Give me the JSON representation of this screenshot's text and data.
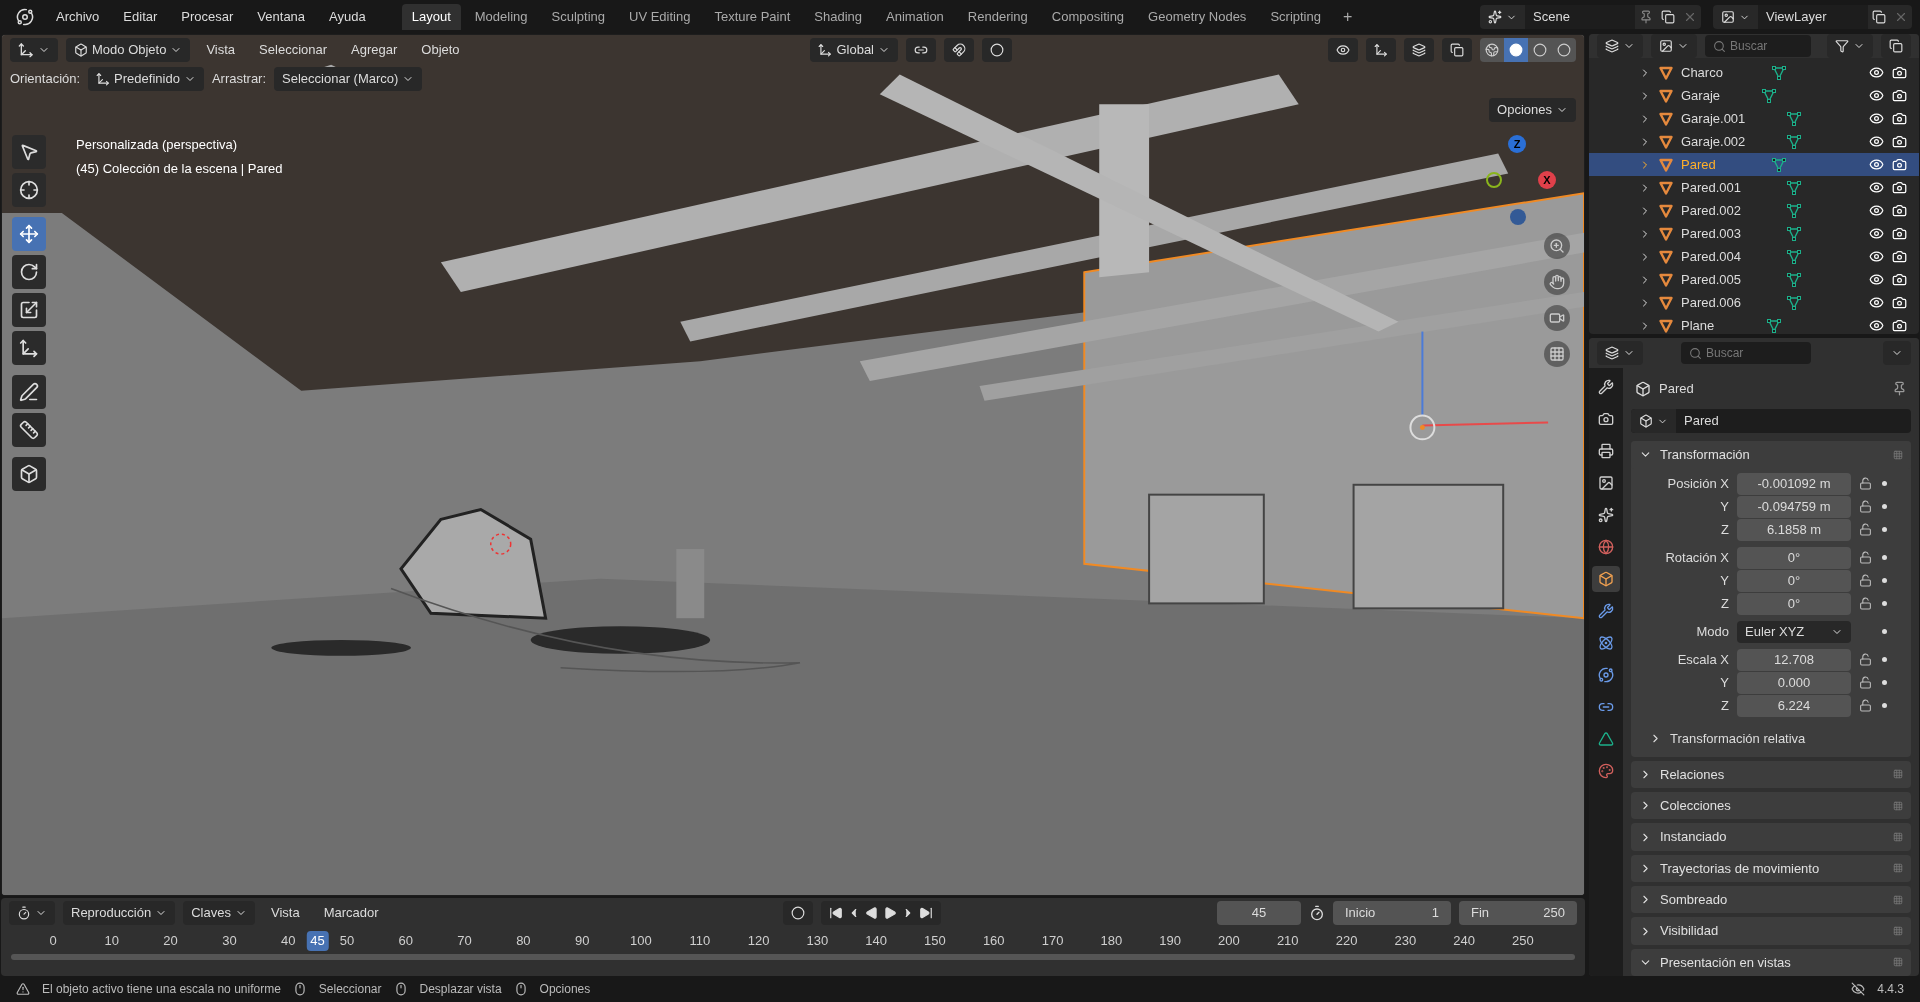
{
  "menu": [
    "Archivo",
    "Editar",
    "Procesar",
    "Ventana",
    "Ayuda"
  ],
  "workspaces": [
    {
      "label": "Layout",
      "selected": true
    },
    {
      "label": "Modeling",
      "selected": false
    },
    {
      "label": "Sculpting",
      "selected": false
    },
    {
      "label": "UV Editing",
      "selected": false
    },
    {
      "label": "Texture Paint",
      "selected": false
    },
    {
      "label": "Shading",
      "selected": false
    },
    {
      "label": "Animation",
      "selected": false
    },
    {
      "label": "Rendering",
      "selected": false
    },
    {
      "label": "Compositing",
      "selected": false
    },
    {
      "label": "Geometry Nodes",
      "selected": false
    },
    {
      "label": "Scripting",
      "selected": false
    }
  ],
  "add_workspace": "+",
  "scene": "Scene",
  "view_layer": "ViewLayer",
  "viewport": {
    "mode": "Modo Objeto",
    "menus": [
      "Vista",
      "Seleccionar",
      "Agregar",
      "Objeto"
    ],
    "transform_orientation": "Global",
    "orientation_label": "Orientación:",
    "orientation_value": "Predefinido",
    "drag_label": "Arrastrar:",
    "drag_value": "Seleccionar (Marco)",
    "options": "Opciones",
    "view_name": "Personalizada (perspectiva)",
    "collection_info": "(45) Colección de la escena | Pared",
    "tools": [
      {
        "kind": "select",
        "selected": false
      },
      {
        "kind": "cursor",
        "selected": false
      },
      {
        "kind": "move",
        "selected": true
      },
      {
        "kind": "rotate",
        "selected": false
      },
      {
        "kind": "scale",
        "selected": false
      },
      {
        "kind": "transform",
        "selected": false
      },
      {
        "kind": "annotate",
        "selected": false
      },
      {
        "kind": "measure",
        "selected": false
      },
      {
        "kind": "add",
        "selected": false
      }
    ],
    "shading_modes": [
      {
        "kind": "wireframe",
        "selected": false
      },
      {
        "kind": "solid",
        "selected": true
      },
      {
        "kind": "material",
        "selected": false
      },
      {
        "kind": "rendered",
        "selected": false
      }
    ],
    "gizmo": {
      "z": "Z",
      "x": "X"
    }
  },
  "outliner": {
    "search": {
      "placeholder": "Buscar"
    },
    "items": [
      {
        "name": "Charco",
        "selected": false
      },
      {
        "name": "Garaje",
        "selected": false
      },
      {
        "name": "Garaje.001",
        "selected": false
      },
      {
        "name": "Garaje.002",
        "selected": false
      },
      {
        "name": "Pared",
        "selected": true
      },
      {
        "name": "Pared.001",
        "selected": false
      },
      {
        "name": "Pared.002",
        "selected": false
      },
      {
        "name": "Pared.003",
        "selected": false
      },
      {
        "name": "Pared.004",
        "selected": false
      },
      {
        "name": "Pared.005",
        "selected": false
      },
      {
        "name": "Pared.006",
        "selected": false
      },
      {
        "name": "Plane",
        "selected": false
      }
    ]
  },
  "properties": {
    "search": {
      "placeholder": "Buscar"
    },
    "tabs": [
      {
        "kind": "tool",
        "selected": false
      },
      {
        "kind": "render",
        "selected": false
      },
      {
        "kind": "output",
        "selected": false
      },
      {
        "kind": "view_layer",
        "selected": false
      },
      {
        "kind": "scene",
        "selected": false
      },
      {
        "kind": "world",
        "selected": false
      },
      {
        "kind": "object",
        "selected": true
      },
      {
        "kind": "modifiers",
        "selected": false
      },
      {
        "kind": "particles",
        "selected": false
      },
      {
        "kind": "physics",
        "selected": false
      },
      {
        "kind": "constraints",
        "selected": false
      },
      {
        "kind": "data",
        "selected": false
      },
      {
        "kind": "material",
        "selected": false
      }
    ],
    "object_name": "Pared",
    "datablock": "Pared",
    "transform": {
      "title": "Transformación",
      "expanded": true,
      "groups": [
        {
          "rows": [
            {
              "label": "Posición X",
              "value": "-0.001092 m"
            },
            {
              "label": "Y",
              "value": "-0.094759 m"
            },
            {
              "label": "Z",
              "value": "6.1858 m"
            }
          ]
        },
        {
          "rows": [
            {
              "label": "Rotación X",
              "value": "0°"
            },
            {
              "label": "Y",
              "value": "0°"
            },
            {
              "label": "Z",
              "value": "0°"
            }
          ]
        },
        {
          "mode_label": "Modo",
          "mode_value": "Euler XYZ"
        },
        {
          "rows": [
            {
              "label": "Escala X",
              "value": "12.708"
            },
            {
              "label": "Y",
              "value": "0.000"
            },
            {
              "label": "Z",
              "value": "6.224"
            }
          ]
        }
      ],
      "subpanel": {
        "title": "Transformación relativa",
        "expanded": false
      }
    },
    "panels": [
      {
        "title": "Relaciones",
        "expanded": false
      },
      {
        "title": "Colecciones",
        "expanded": false
      },
      {
        "title": "Instanciado",
        "expanded": false
      },
      {
        "title": "Trayectorias de movimiento",
        "expanded": false
      },
      {
        "title": "Sombreado",
        "expanded": false
      },
      {
        "title": "Visibilidad",
        "expanded": false
      },
      {
        "title": "Presentación en vistas",
        "expanded": true
      }
    ]
  },
  "timeline": {
    "menus": [
      "Reproducción",
      "Claves",
      "Vista",
      "Marcador"
    ],
    "current_frame": "45",
    "start_label": "Inicio",
    "start": "1",
    "end_label": "Fin",
    "end": "250",
    "ruler": [
      "0",
      "10",
      "20",
      "30",
      "40",
      "50",
      "60",
      "70",
      "80",
      "90",
      "100",
      "110",
      "120",
      "130",
      "140",
      "150",
      "160",
      "170",
      "180",
      "190",
      "200",
      "210",
      "220",
      "230",
      "240",
      "250"
    ],
    "playhead": {
      "frame": "45",
      "level": 0.18
    }
  },
  "status_bar": {
    "warning": "El objeto activo tiene una escala no uniforme",
    "hints": [
      "Seleccionar",
      "Desplazar vista",
      "Opciones"
    ],
    "version": "4.4.3"
  }
}
